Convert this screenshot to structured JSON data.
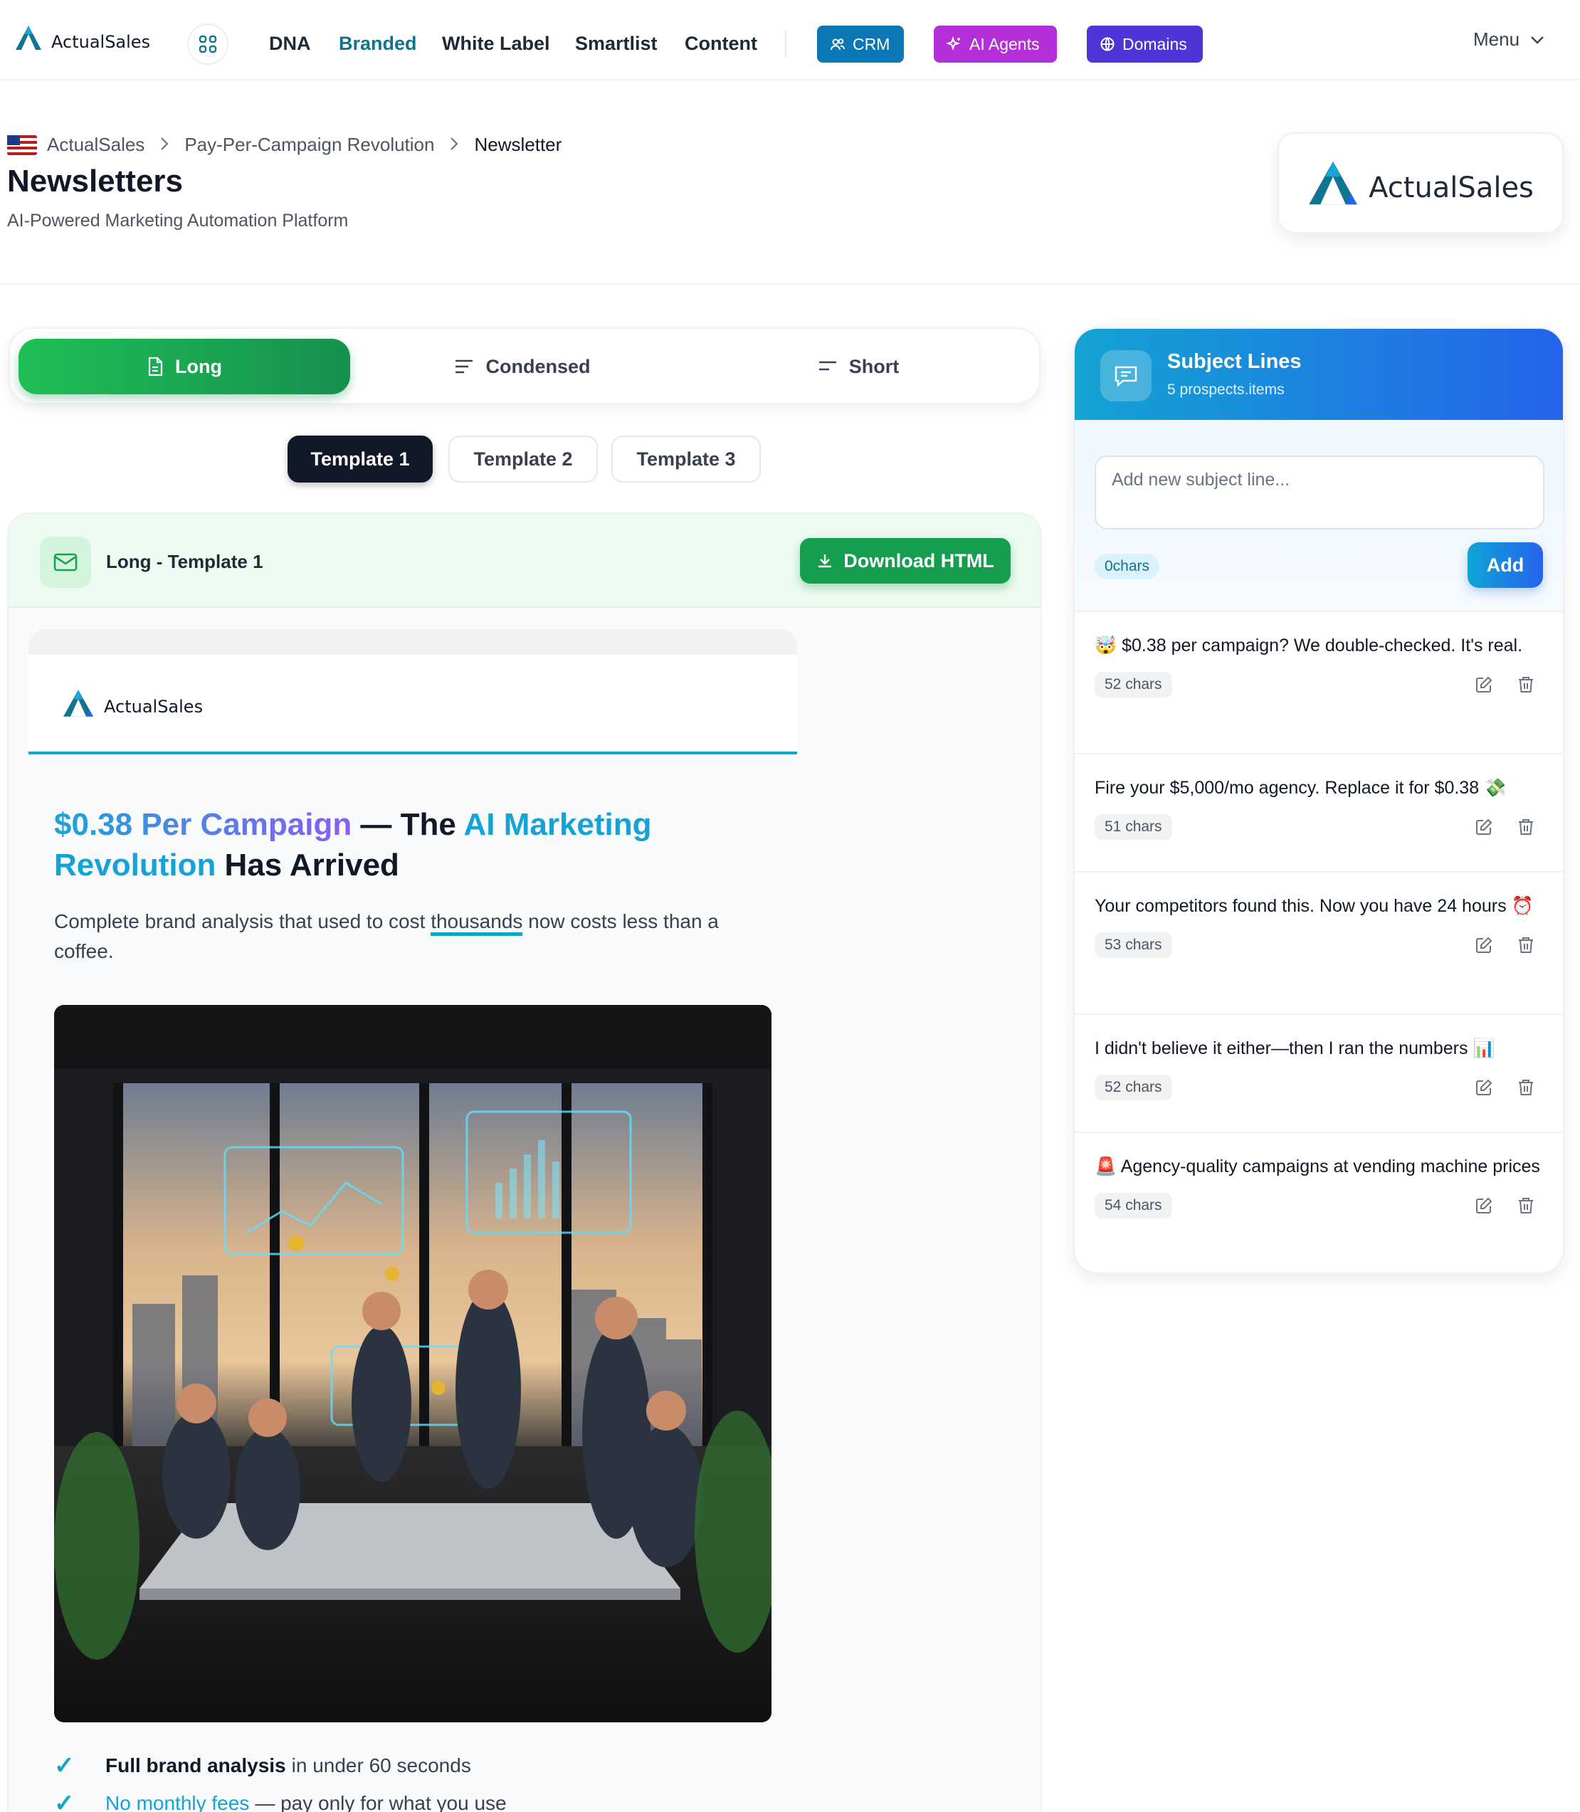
{
  "nav": {
    "logo_text": "ActualSales",
    "links": [
      "DNA",
      "Branded",
      "White Label",
      "Smartlist",
      "Content"
    ],
    "active_link": "Branded",
    "pills": {
      "crm": "CRM",
      "ai": "AI Agents",
      "domains": "Domains"
    },
    "menu_label": "Menu"
  },
  "header": {
    "breadcrumb": [
      "ActualSales",
      "Pay-Per-Campaign Revolution",
      "Newsletter"
    ],
    "title": "Newsletters",
    "subtitle": "AI-Powered Marketing Automation Platform",
    "brand_card_text": "ActualSales"
  },
  "length_tabs": [
    "Long",
    "Condensed",
    "Short"
  ],
  "template_tabs": [
    "Template 1",
    "Template 2",
    "Template 3"
  ],
  "preview": {
    "title": "Long - Template 1",
    "download_label": "Download HTML",
    "email": {
      "logo_text": "ActualSales",
      "headline_1": "$0.38 Per Campaign",
      "headline_2": " — The ",
      "headline_3": "AI Marketing Revolution",
      "headline_4": " Has Arrived",
      "lead_1": "Complete brand analysis that used to cost ",
      "lead_2": "thousands",
      "lead_3": " now costs less than a coffee.",
      "bullets": [
        {
          "bold": "Full brand analysis",
          "rest": "in under 60 seconds"
        },
        {
          "link": "No monthly fees",
          "rest": "— pay only for what you use"
        }
      ]
    }
  },
  "subject_lines": {
    "title": "Subject Lines",
    "subtitle": "5 prospects.items",
    "input_placeholder": "Add new subject line...",
    "char_count": "0chars",
    "add_label": "Add",
    "items": [
      {
        "text": "🤯 $0.38 per campaign? We double-checked. It's real.",
        "chars": "52 chars"
      },
      {
        "text": "Fire your $5,000/mo agency. Replace it for $0.38 💸",
        "chars": "51 chars"
      },
      {
        "text": "Your competitors found this. Now you have 24 hours ⏰",
        "chars": "53 chars"
      },
      {
        "text": "I didn't believe it either—then I ran the numbers 📊",
        "chars": "52 chars"
      },
      {
        "text": "🚨 Agency-quality campaigns at vending machine prices",
        "chars": "54 chars"
      }
    ]
  },
  "colors": {
    "brand_teal": "#0e7490",
    "green": "#169e50",
    "crm": "#0b77b5",
    "ai_agents": "#b42fd8",
    "domains": "#4f35d8",
    "accent_blue": "#2563eb"
  }
}
